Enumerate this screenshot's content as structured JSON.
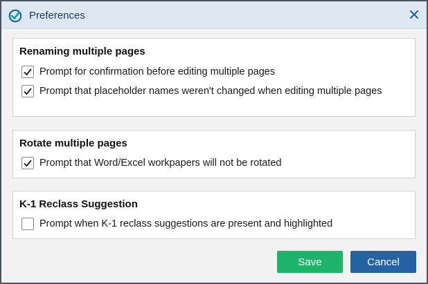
{
  "dialog": {
    "title": "Preferences",
    "icon": "check-logo-icon",
    "close_icon": "close-icon"
  },
  "groups": [
    {
      "title": "Renaming multiple pages",
      "options": [
        {
          "label": "Prompt for confirmation before editing multiple pages",
          "checked": true
        },
        {
          "label": "Prompt that placeholder names weren't changed when editing multiple pages",
          "checked": true
        }
      ]
    },
    {
      "title": "Rotate multiple pages",
      "options": [
        {
          "label": "Prompt that Word/Excel workpapers will not be rotated",
          "checked": true
        }
      ]
    },
    {
      "title": "K-1 Reclass Suggestion",
      "options": [
        {
          "label": "Prompt when K-1 reclass suggestions are present and highlighted",
          "checked": false
        }
      ]
    }
  ],
  "buttons": {
    "save": "Save",
    "cancel": "Cancel"
  },
  "colors": {
    "titlebar": "#dde8f3",
    "save": "#1fb36b",
    "cancel": "#2563a3",
    "logo_teal": "#14a89a",
    "logo_blue": "#1f5fa8"
  }
}
